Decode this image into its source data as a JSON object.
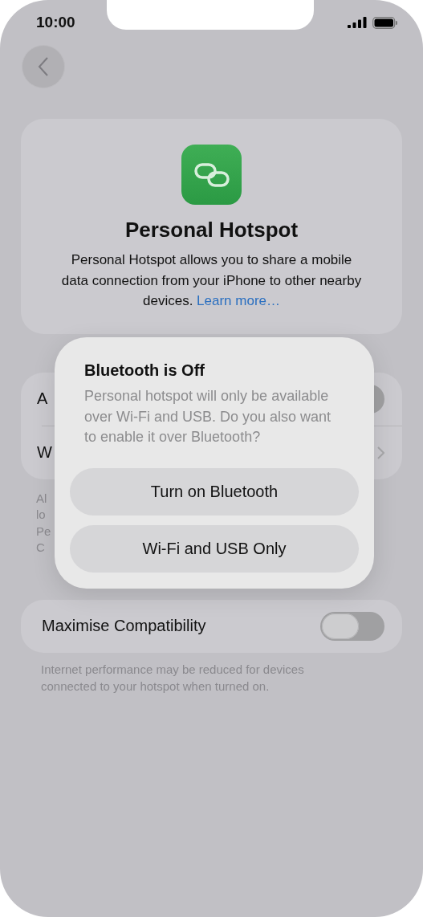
{
  "status_bar": {
    "time": "10:00"
  },
  "header": {
    "title": "Personal Hotspot",
    "description": "Personal Hotspot allows you to share a mobile data connection from your iPhone to other nearby devices.",
    "link": "Learn more…"
  },
  "settings": [
    {
      "label": "A",
      "kind": "toggle",
      "on": false
    },
    {
      "label": "W",
      "kind": "link"
    }
  ],
  "settings_footer": [
    "Al",
    "lo",
    "Pe",
    "C"
  ],
  "compatibility": {
    "label": "Maximise Compatibility",
    "on": false,
    "note": "Internet performance may be reduced for devices connected to your hotspot when turned on."
  },
  "alert": {
    "title": "Bluetooth is Off",
    "message": "Personal hotspot will only be available over Wi-Fi and USB. Do you also want to enable it over Bluetooth?",
    "buttons": [
      "Turn on Bluetooth",
      "Wi-Fi and USB Only"
    ]
  }
}
